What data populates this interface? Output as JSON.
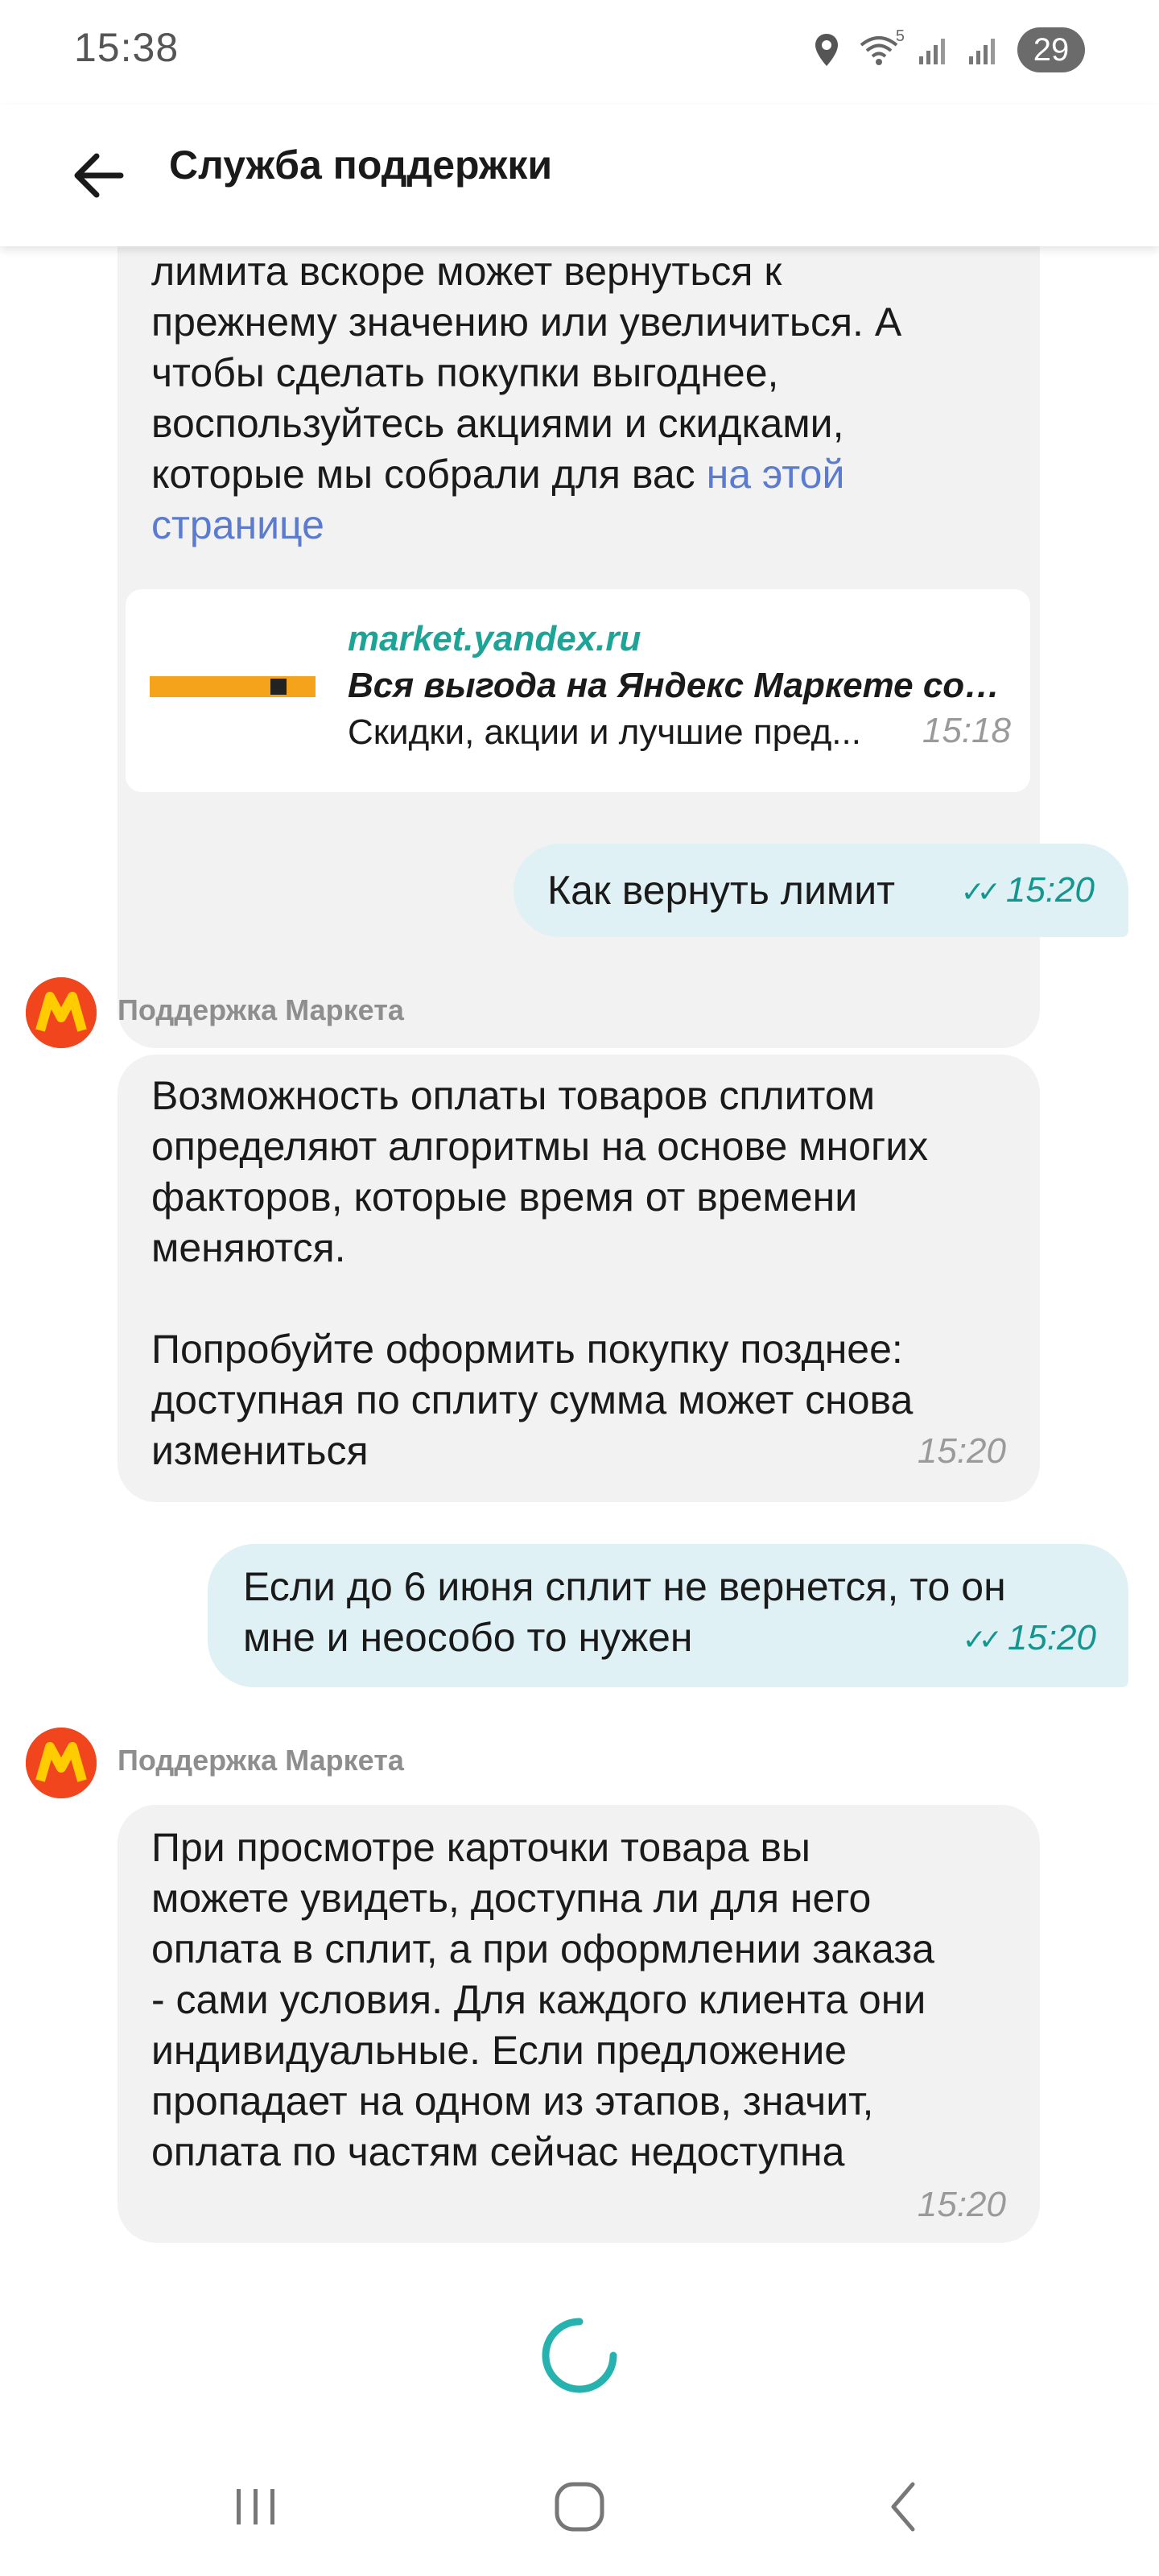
{
  "status_bar": {
    "time": "15:38",
    "wifi_label": "5",
    "battery": "29"
  },
  "header": {
    "title": "Служба поддержки"
  },
  "messages": [
    {
      "text_lines": [
        "лимита вскоре может вернуться к",
        "прежнему значению или увеличиться. А",
        "чтобы сделать покупки выгоднее,",
        "воспользуйтесь акциями и скидками,",
        "которые мы собрали для вас "
      ],
      "link_text_1": "на этой",
      "link_text_2": "странице",
      "card": {
        "site": "market.yandex.ru",
        "title": "Вся выгода на Яндекс Маркете собр...",
        "description": "Скидки, акции и лучшие пред...",
        "time": "15:18"
      }
    },
    {
      "text": "Как вернуть лимит",
      "time": "15:20",
      "ticks": "✓✓"
    },
    {
      "sender": "Поддержка Маркета",
      "lines": [
        "Возможность оплаты товаров сплитом",
        "определяют алгоритмы на основе многих",
        "факторов, которые время от времени",
        "меняются.",
        "",
        "Попробуйте оформить покупку позднее:",
        "доступная по сплиту сумма может снова",
        "измениться"
      ],
      "time": "15:20"
    },
    {
      "lines": [
        "Если до 6 июня сплит не вернется, то он",
        "мне и неособо то нужен"
      ],
      "time": "15:20",
      "ticks": "✓✓"
    },
    {
      "sender": "Поддержка Маркета",
      "lines": [
        "При просмотре карточки товара вы",
        "можете увидеть, доступна ли для него",
        "оплата в сплит, а при оформлении заказа",
        "- сами условия. Для каждого клиента они",
        "индивидуальные. Если предложение",
        "пропадает на одном из этапов, значит,",
        "оплата по частям сейчас недоступна"
      ],
      "time": "15:20"
    }
  ],
  "colors": {
    "incoming_bubble": "#f2f2f2",
    "outgoing_bubble": "#dff1f5",
    "accent_teal": "#14958e",
    "link": "#5b7bd0",
    "avatar": "#f0451d"
  },
  "icons": {
    "back": "arrow-left-icon",
    "avatar": "yandex-market-logo",
    "spinner": "loading-spinner-icon",
    "nav_recents": "recents-icon",
    "nav_home": "home-icon",
    "nav_back": "back-icon"
  }
}
